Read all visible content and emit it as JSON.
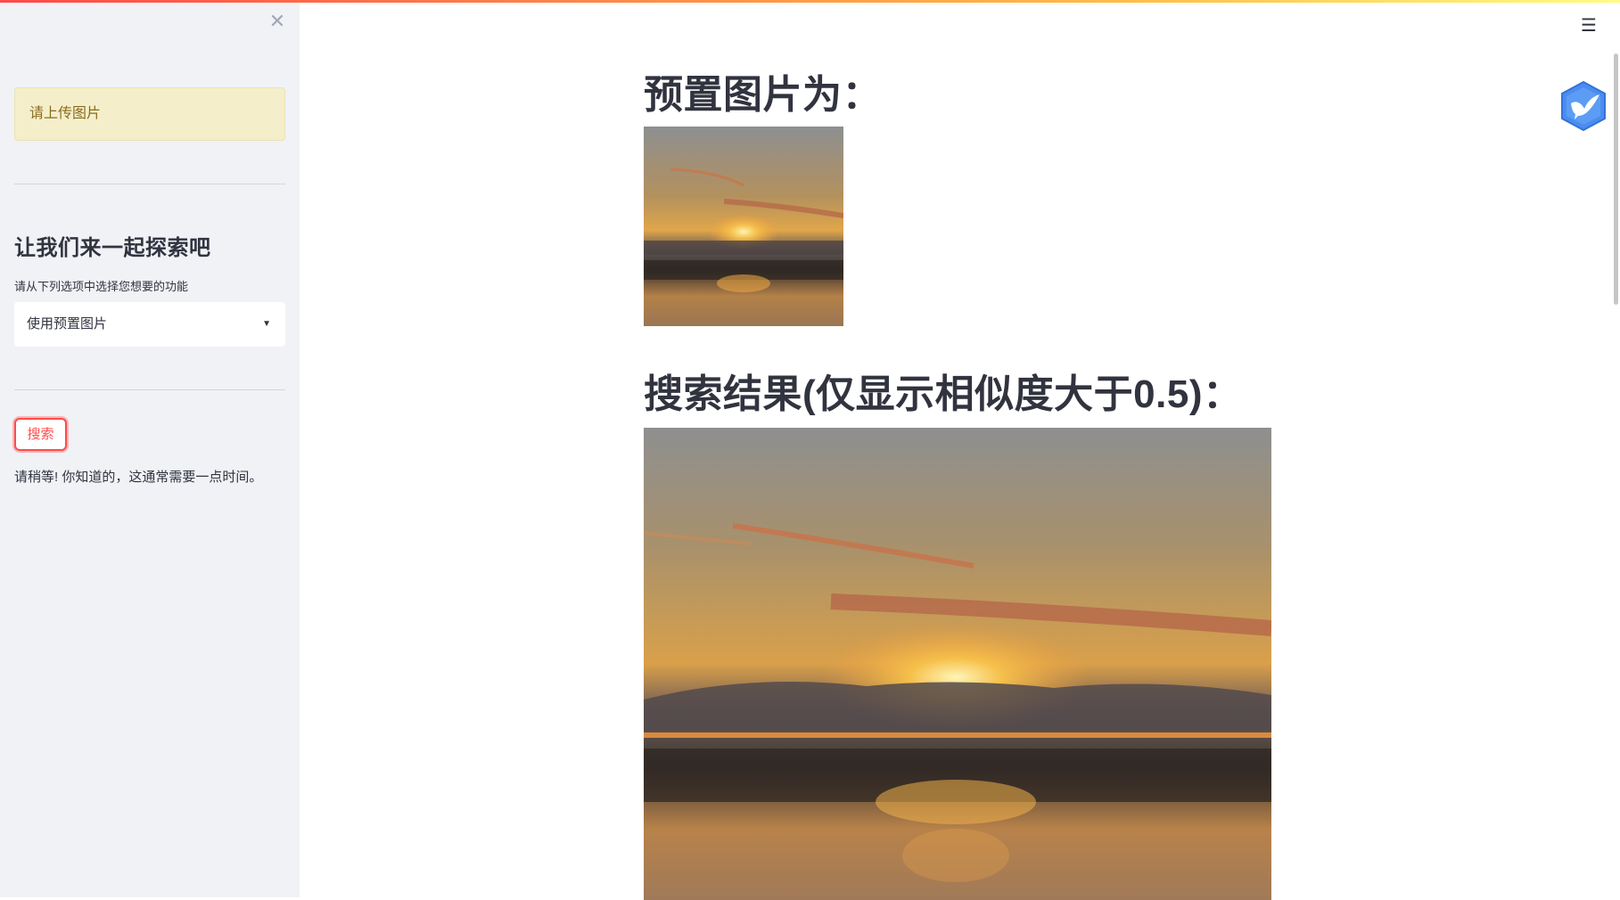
{
  "sidebar": {
    "close_icon": "close-icon",
    "alert_text": "请上传图片",
    "heading": "让我们来一起探索吧",
    "select_label": "请从下列选项中选择您想要的功能",
    "select_value": "使用预置图片",
    "search_button": "搜索",
    "wait_text": "请稍等! 你知道的，这通常需要一点时间。"
  },
  "main": {
    "menu_icon": "hamburger-menu-icon",
    "badge_icon": "bird-hexagon-icon",
    "preset_heading": "预置图片为：",
    "result_heading": "搜索结果(仅显示相似度大于0.5)："
  },
  "colors": {
    "accent": "#ff4b4b",
    "sidebar_bg": "#f0f2f6",
    "alert_bg": "#f4eecb",
    "alert_text": "#8a6d1c",
    "text": "#31333f"
  }
}
